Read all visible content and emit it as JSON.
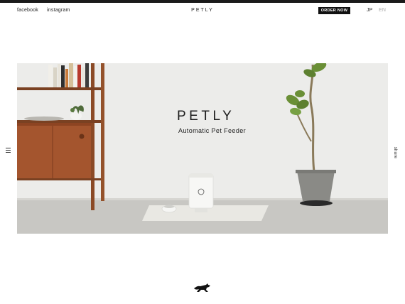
{
  "header": {
    "links": [
      "facebook",
      "instagram"
    ],
    "brand": "PETLY",
    "order_label": "ORDER NOW",
    "lang": [
      "JP",
      "EN"
    ]
  },
  "hero": {
    "title": "PETLY",
    "subtitle": "Automatic Pet Feeder"
  },
  "side": {
    "share_label": "share"
  },
  "icons": {
    "menu": "hamburger-menu-icon",
    "scroll": "running-cat-icon"
  },
  "colors": {
    "order_bg": "#111111",
    "wall": "#ececea",
    "floor": "#c9c8c4",
    "wood": "#a0522d"
  }
}
